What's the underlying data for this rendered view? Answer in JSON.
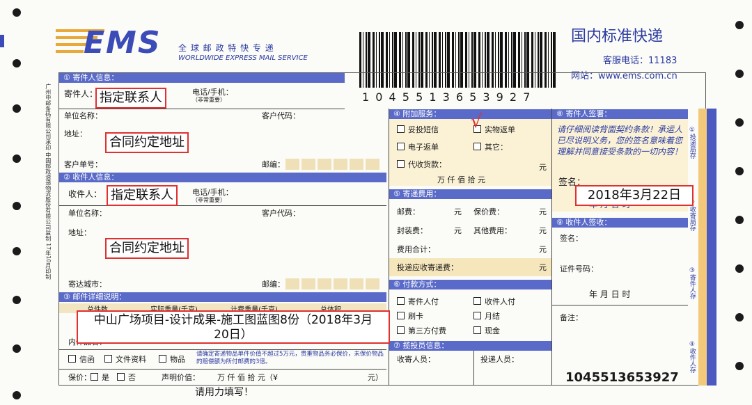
{
  "brand": {
    "logo_text": "EMS",
    "cn_slogan": "全 球 邮 政 特 快 专 递",
    "en_slogan": "WORLDWIDE EXPRESS MAIL SERVICE",
    "product": "国内标准快递",
    "hotline": "客服电话：11183",
    "website": "网站：www.ems.com.cn"
  },
  "barcode_number": "1 0 4 5 5 1 3 6 5 3 9 2 7",
  "tracking_number": "1045513653927",
  "side_print": {
    "left": "广州中邮条码有限公司承印  中国邮政速递物流股份有限公司监制  17年10月印制",
    "copies": [
      "①投递局存",
      "②收寄局存",
      "③寄件人存",
      "④收件人存"
    ]
  },
  "sender": {
    "header": "① 寄件人信息：",
    "name_label": "寄件人：",
    "phone_label": "电话/手机：",
    "phone_note": "（非常重要）",
    "company_label": "单位名称：",
    "customer_code_label": "客户代码：",
    "address_label": "地址：",
    "customer_no_label": "客户单号：",
    "postcode_label": "邮编："
  },
  "receiver": {
    "header": "② 收件人信息：",
    "name_label": "收件人：",
    "phone_label": "电话/手机：",
    "phone_note": "（非常重要）",
    "company_label": "单位名称：",
    "customer_code_label": "客户代码：",
    "address_label": "地址：",
    "city_label": "寄达城市：",
    "postcode_label": "邮编："
  },
  "mail_details": {
    "header": "③ 邮件详细说明：",
    "columns": [
      "总件数",
      "实际重量(千克)",
      "计费重量(千克)",
      "总体积"
    ],
    "contents_label": "内件品名：",
    "types": [
      "信函",
      "文件资料",
      "物品"
    ],
    "notice": "请确定寄递物品单件价值不超过5万元，贵重物品务必保价，未保价物品的赔偿额为所付邮费的3倍。",
    "insurance_label": "保价：",
    "yes": "是",
    "no": "否",
    "declared_label": "声明价值：",
    "amount_units": "万   仟   佰   拾   元（¥",
    "amount_end": "元）"
  },
  "value_added": {
    "header": "④ 附加服务：",
    "items": [
      "妥投短信",
      "实物返单",
      "电子返单",
      "其它：",
      "代收货款："
    ],
    "unit": "元",
    "amount_units": "万    仟    佰    拾    元",
    "checkmark": "√"
  },
  "fees": {
    "header": "⑤ 寄递费用：",
    "postage": "邮费：",
    "insurance": "保价费：",
    "packing": "封装费：",
    "other": "其他费用：",
    "total": "费用合计：",
    "due": "投递应收寄递费：",
    "unit": "元"
  },
  "payment": {
    "header": "⑥ 付款方式：",
    "items": [
      "寄件人付",
      "收件人付",
      "刷卡",
      "月结",
      "第三方付费",
      "现金"
    ]
  },
  "courier": {
    "header": "⑦ 揽投员信息：",
    "collector": "收寄人员：",
    "deliverer": "投递人员："
  },
  "sender_signature": {
    "header": "⑧ 寄件人签署：",
    "notice": "请仔细阅读背面契约条款！承运人已尽说明义务，您的签名意味着您理解并同意接受条款的一切内容！",
    "sign_label": "签名：",
    "date_units": "年    月    日    时"
  },
  "receiver_signature": {
    "header": "⑨ 收件人签收：",
    "sign_label": "签名：",
    "id_label": "证件号码：",
    "date_units": "年      月      日      时",
    "remark_label": "备注："
  },
  "footer": "请用力填写！",
  "overlays": {
    "sender_name": "指定联系人",
    "sender_address": "合同约定地址",
    "receiver_name": "指定联系人",
    "receiver_address": "合同约定地址",
    "contents_line1": "中山广场项目-设计成果-施工图蓝图8份（2018年3月",
    "contents_line2": "20日）",
    "sign_date": "2018年3月22日"
  }
}
